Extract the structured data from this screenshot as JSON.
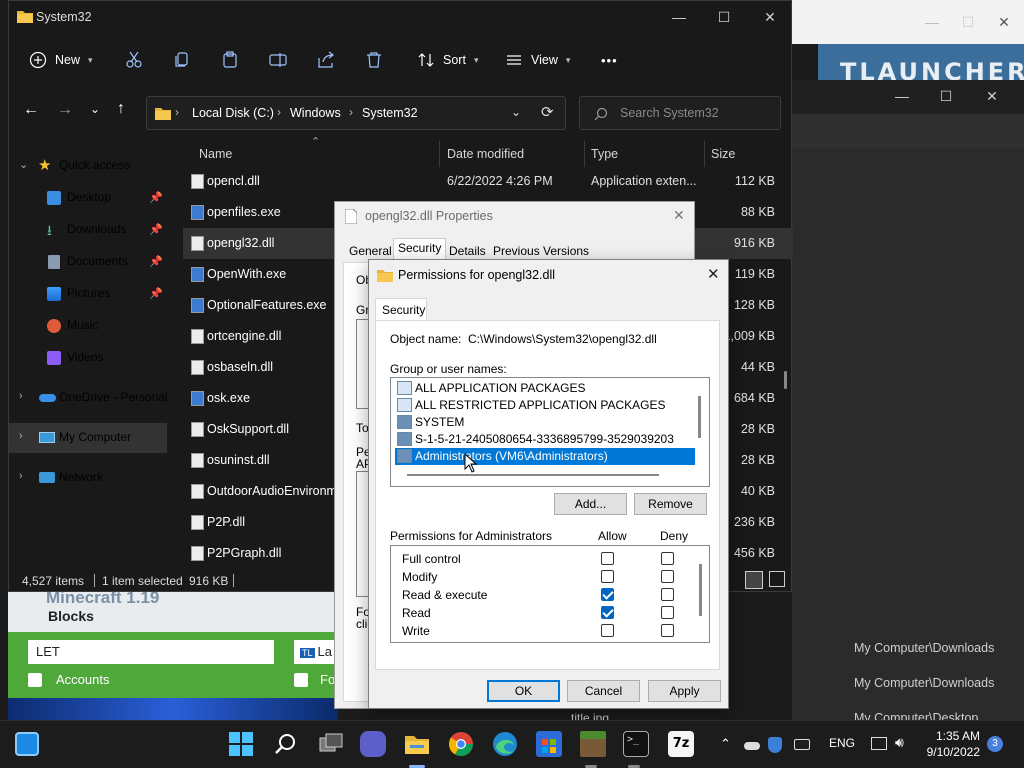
{
  "explorer": {
    "title": "System32",
    "commands": {
      "new": "New",
      "sort": "Sort",
      "view": "View",
      "more": "•••"
    },
    "breadcrumb": [
      "Local Disk (C:)",
      "Windows",
      "System32"
    ],
    "search_placeholder": "Search System32",
    "nav": {
      "quick_access": "Quick access",
      "items": [
        {
          "label": "Desktop",
          "icon": "desktop-icon",
          "pinned": true
        },
        {
          "label": "Downloads",
          "icon": "download-icon",
          "pinned": true
        },
        {
          "label": "Documents",
          "icon": "documents-icon",
          "pinned": true
        },
        {
          "label": "Pictures",
          "icon": "pictures-icon",
          "pinned": true
        },
        {
          "label": "Music",
          "icon": "music-icon",
          "pinned": false
        },
        {
          "label": "Videos",
          "icon": "videos-icon",
          "pinned": false
        }
      ],
      "onedrive": "OneDrive - Personal",
      "computer": "My Computer",
      "network": "Network"
    },
    "columns": {
      "name": "Name",
      "date": "Date modified",
      "type": "Type",
      "size": "Size"
    },
    "files": [
      {
        "name": "opencl.dll",
        "date": "6/22/2022 4:26 PM",
        "type": "Application exten...",
        "size": "112 KB"
      },
      {
        "name": "openfiles.exe",
        "date": "",
        "type": "",
        "size": "88 KB"
      },
      {
        "name": "opengl32.dll",
        "date": "",
        "type": "",
        "size": "916 KB"
      },
      {
        "name": "OpenWith.exe",
        "date": "",
        "type": "",
        "size": "119 KB"
      },
      {
        "name": "OptionalFeatures.exe",
        "date": "",
        "type": "",
        "size": "128 KB"
      },
      {
        "name": "ortcengine.dll",
        "date": "",
        "type": "",
        "size": "1,009 KB"
      },
      {
        "name": "osbaseln.dll",
        "date": "",
        "type": "",
        "size": "44 KB"
      },
      {
        "name": "osk.exe",
        "date": "",
        "type": "",
        "size": "684 KB"
      },
      {
        "name": "OskSupport.dll",
        "date": "",
        "type": "",
        "size": "28 KB"
      },
      {
        "name": "osuninst.dll",
        "date": "",
        "type": "",
        "size": "28 KB"
      },
      {
        "name": "OutdoorAudioEnvironm",
        "date": "",
        "type": "",
        "size": "40 KB"
      },
      {
        "name": "P2P.dll",
        "date": "",
        "type": "",
        "size": "236 KB"
      },
      {
        "name": "P2PGraph.dll",
        "date": "",
        "type": "",
        "size": "456 KB"
      }
    ],
    "status": {
      "count": "4,527 items",
      "selected": "1 item selected",
      "size": "916 KB"
    }
  },
  "properties": {
    "title": "opengl32.dll Properties",
    "tabs": [
      "General",
      "Security",
      "Details",
      "Previous Versions"
    ],
    "fragments": {
      "obj": "Ob",
      "grp": "Gr",
      "to": "To",
      "pe": "Pe",
      "ap": "AP",
      "for": "For",
      "cli": "clic"
    }
  },
  "permissions": {
    "title": "Permissions for opengl32.dll",
    "tab": "Security",
    "object_label": "Object name:",
    "object_value": "C:\\Windows\\System32\\opengl32.dll",
    "groups_label": "Group or user names:",
    "groups": [
      "ALL APPLICATION PACKAGES",
      "ALL RESTRICTED APPLICATION PACKAGES",
      "SYSTEM",
      "S-1-5-21-2405080654-3336895799-3529039203",
      "Administrators (VM6\\Administrators)"
    ],
    "add": "Add...",
    "remove": "Remove",
    "perms_label": "Permissions for Administrators",
    "allow": "Allow",
    "deny": "Deny",
    "perms": [
      {
        "name": "Full control",
        "allow": false,
        "deny": false
      },
      {
        "name": "Modify",
        "allow": false,
        "deny": false
      },
      {
        "name": "Read & execute",
        "allow": true,
        "deny": false
      },
      {
        "name": "Read",
        "allow": true,
        "deny": false
      },
      {
        "name": "Write",
        "allow": false,
        "deny": false
      }
    ],
    "ok": "OK",
    "cancel": "Cancel",
    "apply": "Apply"
  },
  "background": {
    "launcher_brand": "TLAUNCHER",
    "game_title": "Minecraft 1.19",
    "game_sub": "Blocks",
    "game_input": "LET",
    "game_input2": "La",
    "accounts": "Accounts",
    "fo": "Fo",
    "recent": [
      "My Computer\\Downloads",
      "My Computer\\Downloads",
      "My Computer\\Desktop"
    ],
    "title_jpg": "title.jpg"
  },
  "taskbar": {
    "lang": "ENG",
    "time": "1:35 AM",
    "date": "9/10/2022",
    "badge": "3"
  }
}
